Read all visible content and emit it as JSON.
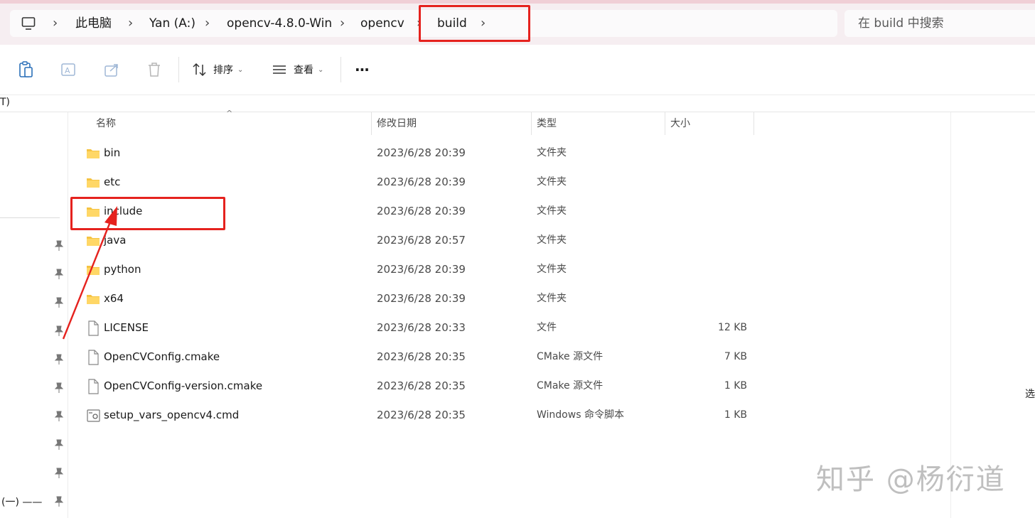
{
  "breadcrumb": {
    "items": [
      "此电脑",
      "Yan (A:)",
      "opencv-4.8.0-Win",
      "opencv",
      "build"
    ]
  },
  "search": {
    "placeholder": "在 build 中搜索"
  },
  "toolbar": {
    "sort_label": "排序",
    "view_label": "查看",
    "more_label": "···"
  },
  "subrow_fragment": "T)",
  "columns": {
    "name": "名称",
    "date": "修改日期",
    "type": "类型",
    "size": "大小"
  },
  "files": [
    {
      "name": "bin",
      "date": "2023/6/28 20:39",
      "type": "文件夹",
      "size": "",
      "icon": "folder-icon"
    },
    {
      "name": "etc",
      "date": "2023/6/28 20:39",
      "type": "文件夹",
      "size": "",
      "icon": "folder-icon"
    },
    {
      "name": "include",
      "date": "2023/6/28 20:39",
      "type": "文件夹",
      "size": "",
      "icon": "folder-icon"
    },
    {
      "name": "java",
      "date": "2023/6/28 20:57",
      "type": "文件夹",
      "size": "",
      "icon": "folder-icon"
    },
    {
      "name": "python",
      "date": "2023/6/28 20:39",
      "type": "文件夹",
      "size": "",
      "icon": "folder-icon"
    },
    {
      "name": "x64",
      "date": "2023/6/28 20:39",
      "type": "文件夹",
      "size": "",
      "icon": "folder-icon"
    },
    {
      "name": "LICENSE",
      "date": "2023/6/28 20:33",
      "type": "文件",
      "size": "12 KB",
      "icon": "file-icon"
    },
    {
      "name": "OpenCVConfig.cmake",
      "date": "2023/6/28 20:35",
      "type": "CMake 源文件",
      "size": "7 KB",
      "icon": "file-icon"
    },
    {
      "name": "OpenCVConfig-version.cmake",
      "date": "2023/6/28 20:35",
      "type": "CMake 源文件",
      "size": "1 KB",
      "icon": "file-icon"
    },
    {
      "name": "setup_vars_opencv4.cmd",
      "date": "2023/6/28 20:35",
      "type": "Windows 命令脚本",
      "size": "1 KB",
      "icon": "cmd-file-icon"
    }
  ],
  "nav_fragment": "(一) ——",
  "edge_fragment": "选",
  "watermark": "知乎 @杨衍道",
  "colors": {
    "highlight_red": "#e5221e",
    "folder_yellow": "#f5c342",
    "address_bg": "#f6eef1"
  }
}
